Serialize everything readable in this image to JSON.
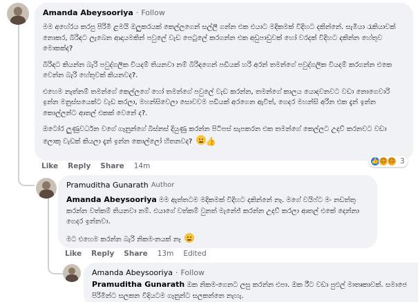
{
  "comment1": {
    "author": "Amanda Abeysooriya",
    "separator": "·",
    "follow_label": "Follow",
    "paragraphs": [
      "මම අහේරය කරපු පිරිමි ළමයි ඔලුකරයක් කෙල්ලගෙන් සල්ලි ගන්න එක එයාට මදිකමක් විදිහට දකින්නේ. සැමියා රැකියාවක් නොකර, බිරිඳට ලැබෙන ආදායමකින් පවුලේ වැඩ පෙටුලේ කරගන්න එක අඩුපාඩුවක් හෝ වරදක් විදිහට දකින්න හේතුව මොකක්ද?",
      "බිරිඳට කියන්න බැරි පවුද්ගලික වියදම් තියනවා නම් බිරිඳගෙන් පඩියක් හරි අරන් තමන්ගේ පවුද්ගලික වියදම් කරගන්න එකෙ වෙන්න බැරි හේතුවක් කියනවද?.",
      "එහෙම නැත්නම් තමන්ගේ කෙල්ලගේ හෝ තමන්ගේ පවුලේ වැඩ කරන්න, තමන්ගේ කාලය යොදවනවට වඩා නොගෙවාරි ඉන්න මනුස්සයෙක්ට වැඩ කරලා, මහන්සිවෙලා සොවවම පඩියක් අරගෙන ඇවිත්, ගෙදර මහන්සි අරින එක දැන් ඉන්න කොල්ලන්ට ආතල් එකක් වෙනේ ද?.",
      "ඔටෝර ලුණුවර්ධන වගේ ගෑනුන්ගේ බිස්නස් දියුණු කරන්න පිටිපස් සැපකරන එක තමන්ගේ කෙල්ලට උදව් කරනවට වඩා ලොකු වැඩක් කියලා දැන් ඉන්න කොල්ලෝ හිතනවද?"
    ],
    "actions": {
      "like": "Like",
      "reply": "Reply",
      "share": "Share",
      "time": "14m"
    },
    "reaction_count": "3"
  },
  "comment2": {
    "author": "Pramuditha Gunarath",
    "author_badge": "Author",
    "mention": "Amanda Abeysooriya",
    "paragraph1": "මම ඇත්තටම මදිකමක් විදිහට දකින්නේ නෑ. මගේ වයිෆ්ට මං නඩත්තු කරන්න වත්කම් තියනවා නම්. එයාගේ වත්කම් වුනත් මැනේජ් කරන්න උදව් කරලා ආතල් එකේ දෙන්නා ගෙදර ඉන්නවා.",
    "paragraph2": "මට එහෙම කරන්න බැරි නිකමංනයක් නෑ",
    "actions": {
      "like": "Like",
      "reply": "Reply",
      "share": "Share",
      "time": "13m",
      "edited": "Edited"
    }
  },
  "comment3": {
    "author": "Amanda Abeysooriya",
    "separator": "·",
    "follow_label": "Follow",
    "mention": "Pramuditha Gunarath",
    "paragraph1": "ඔක නිකමංගෙනට ලසු කරන්න එපා. ඔක රීට වඩා පුළුල් මාතෘකාවක්. සමාජෙ පිරිමින්ට සලකන විදියටම ගෑනුන්ට සලකන්නෙ නැහැ."
  }
}
